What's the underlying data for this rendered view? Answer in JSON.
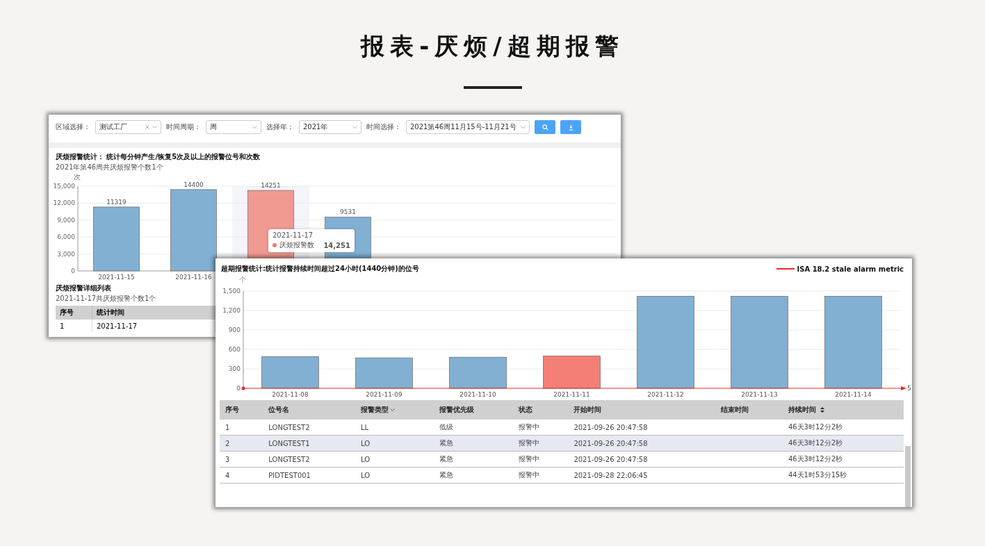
{
  "page_title": "报表-厌烦/超期报警",
  "nuisance_window": {
    "filters": [
      {
        "label": "区域选择：",
        "value": "测试工厂",
        "clearable": true
      },
      {
        "label": "时间周期：",
        "value": "周",
        "clearable": false
      },
      {
        "label": "选择年：",
        "value": "2021年",
        "clearable": false
      },
      {
        "label": "时间选择：",
        "value": "2021第46周11月15号-11月21号",
        "clearable": false
      }
    ],
    "chart_title": "厌烦报警统计： 统计每分钟产生/恢复5次及以上的报警位号和次数",
    "chart_subtitle": "2021年第46周共厌烦报警个数1个",
    "chart_data": {
      "type": "bar",
      "ylabel": "次",
      "categories": [
        "2021-11-15",
        "2021-11-16",
        null,
        null
      ],
      "stacked": true,
      "grid": true,
      "series": [
        {
          "color": "#82b0d2",
          "values": [
            11319,
            14400,
            null,
            9531
          ]
        },
        {
          "name": "厌烦报警数",
          "color": "#f09a92",
          "values": [
            null,
            null,
            14251,
            null
          ]
        }
      ],
      "ylim": [
        0,
        15000
      ],
      "yticks": [
        {
          "value": 0,
          "label": "0"
        },
        {
          "value": 3000,
          "label": "3,000"
        },
        {
          "value": 6000,
          "label": "6,000"
        },
        {
          "value": 9000,
          "label": "9,000"
        },
        {
          "value": 12000,
          "label": "12,000"
        },
        {
          "value": 15000,
          "label": "15,000"
        }
      ],
      "data_labels": true
    },
    "tooltip": {
      "title": "2021-11-17",
      "value": "14,251",
      "color": "#f07a72"
    },
    "table_title": "厌烦报警详细列表",
    "table_subtitle": "2021-11-17共厌烦报警个数1个",
    "table": {
      "columns": [
        "序号",
        "统计时间"
      ],
      "rows": [
        [
          "1",
          "2021-11-17"
        ]
      ]
    }
  },
  "stale_window": {
    "chart_title": "超期报警统计:统计报警持续时间超过24小时(1440分钟)的位号",
    "legend": {
      "label": "ISA 18.2 stale alarm metric",
      "color": "#e8262d"
    },
    "axis_end_label": "5",
    "chart_data": {
      "type": "bar",
      "ylabel": "个",
      "categories": [
        "2021-11-08",
        "2021-11-09",
        "2021-11-10",
        "2021-11-11",
        "2021-11-12",
        "2021-11-13",
        "2021-11-14"
      ],
      "stacked": true,
      "grid": true,
      "series": [
        {
          "color": "#82b0d2",
          "values": [
            490,
            470,
            480,
            null,
            1420,
            1420,
            1420
          ]
        },
        {
          "color": "#f37f76",
          "values": [
            null,
            null,
            null,
            500,
            null,
            null,
            null
          ]
        }
      ],
      "ylim": [
        0,
        1500
      ],
      "yticks": [
        {
          "value": 0,
          "label": "0"
        },
        {
          "value": 300,
          "label": "300"
        },
        {
          "value": 600,
          "label": "600"
        },
        {
          "value": 900,
          "label": "900"
        },
        {
          "value": 1200,
          "label": "1,200"
        },
        {
          "value": 1500,
          "label": "1,500"
        }
      ]
    },
    "table": {
      "columns": [
        {
          "label": "序号",
          "filterable": false,
          "sortable": false
        },
        {
          "label": "位号名",
          "filterable": false,
          "sortable": false
        },
        {
          "label": "报警类型",
          "filterable": true,
          "sortable": false
        },
        {
          "label": "报警优先级",
          "filterable": false,
          "sortable": false
        },
        {
          "label": "状态",
          "filterable": false,
          "sortable": false
        },
        {
          "label": "开始时间",
          "filterable": false,
          "sortable": false
        },
        {
          "label": "结束时间",
          "filterable": false,
          "sortable": false
        },
        {
          "label": "持续时间",
          "filterable": false,
          "sortable": true
        }
      ],
      "rows": [
        {
          "selected": false,
          "cells": [
            "1",
            "LONGTEST2",
            "LL",
            "低级",
            "报警中",
            "2021-09-26 20:47:58",
            "",
            "46天3时12分2秒"
          ]
        },
        {
          "selected": true,
          "cells": [
            "2",
            "LONGTEST1",
            "LO",
            "紧急",
            "报警中",
            "2021-09-26 20:47:58",
            "",
            "46天3时12分2秒"
          ]
        },
        {
          "selected": false,
          "cells": [
            "3",
            "LONGTEST2",
            "LO",
            "紧急",
            "报警中",
            "2021-09-26 20:47:58",
            "",
            "46天3时12分2秒"
          ]
        },
        {
          "selected": false,
          "cells": [
            "4",
            "PIDTEST001",
            "LO",
            "紧急",
            "报警中",
            "2021-09-28 22:06:45",
            "",
            "44天1时53分15秒"
          ]
        }
      ]
    }
  }
}
